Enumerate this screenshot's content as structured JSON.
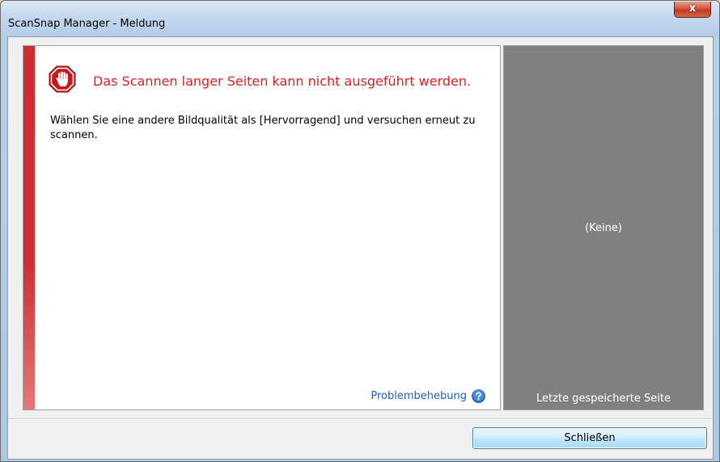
{
  "window": {
    "title": "ScanSnap Manager - Meldung",
    "close_glyph": "x"
  },
  "message": {
    "icon": "stop-hand-icon",
    "headline": "Das Scannen langer Seiten kann nicht ausgeführt werden.",
    "body": "Wählen Sie eine andere Bildqualität als [Hervorragend] und versuchen erneut zu scannen.",
    "help_link_label": "Problembehebung",
    "help_icon": "help-question-icon"
  },
  "preview": {
    "placeholder": "(Keine)",
    "caption": "Letzte gespeicherte Seite"
  },
  "footer": {
    "close_button_label": "Schließen"
  },
  "colors": {
    "headline": "#e11d1d",
    "accent_bar": "#d12b30",
    "link": "#1e5fb4",
    "preview_bg": "#808080"
  }
}
